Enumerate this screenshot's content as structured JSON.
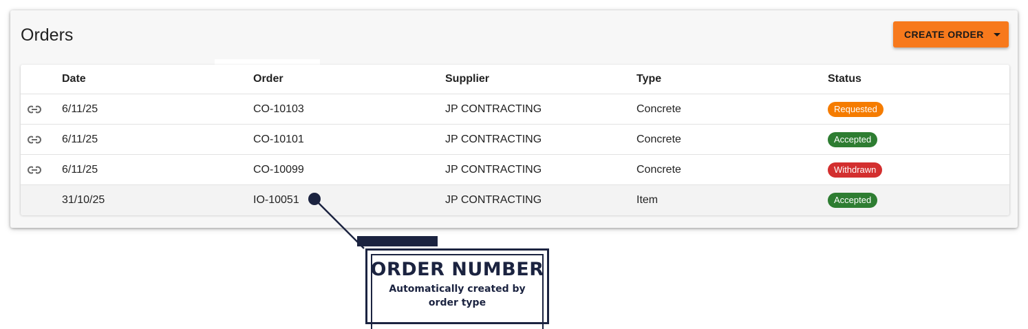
{
  "header": {
    "title": "Orders",
    "create_button_label": "CREATE ORDER"
  },
  "table": {
    "columns": [
      "Date",
      "Order",
      "Supplier",
      "Type",
      "Status"
    ],
    "rows": [
      {
        "linked": true,
        "date": "6/11/25",
        "order": "CO-10103",
        "supplier": "JP CONTRACTING",
        "type": "Concrete",
        "status": "Requested",
        "status_color": "#f57c00"
      },
      {
        "linked": true,
        "date": "6/11/25",
        "order": "CO-10101",
        "supplier": "JP CONTRACTING",
        "type": "Concrete",
        "status": "Accepted",
        "status_color": "#2e7d32"
      },
      {
        "linked": true,
        "date": "6/11/25",
        "order": "CO-10099",
        "supplier": "JP CONTRACTING",
        "type": "Concrete",
        "status": "Withdrawn",
        "status_color": "#d32f2f"
      },
      {
        "linked": false,
        "date": "31/10/25",
        "order": "IO-10051",
        "supplier": "JP CONTRACTING",
        "type": "Item",
        "status": "Accepted",
        "status_color": "#2e7d32"
      }
    ]
  },
  "callout": {
    "title": "ORDER NUMBER",
    "subtitle_line1": "Automatically created by",
    "subtitle_line2": "order type"
  },
  "colors": {
    "accent": "#f7791c",
    "callout": "#1b2340"
  },
  "icons": {
    "row_link": "link-icon",
    "button_caret": "caret-down-icon"
  }
}
